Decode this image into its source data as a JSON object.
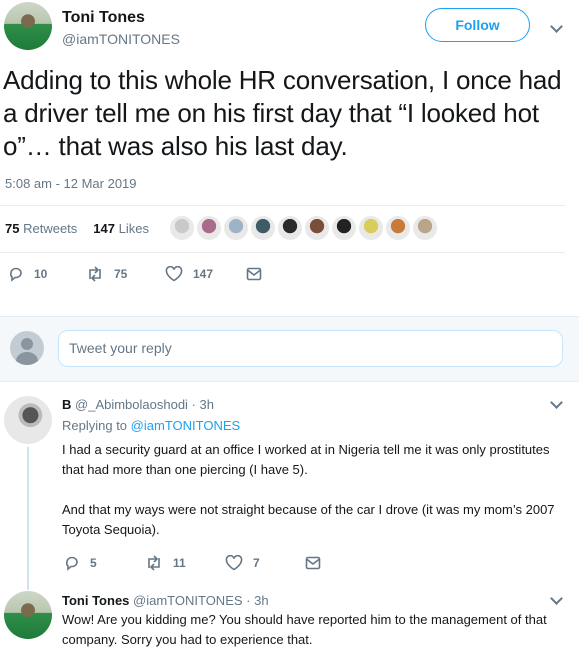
{
  "tweet": {
    "author_name": "Toni Tones",
    "author_handle": "@iamTONITONES",
    "follow_label": "Follow",
    "text": "Adding to this whole HR conversation, I once had a driver tell me on his first day that “I looked hot o”… that was also his last day.",
    "timestamp": "5:08 am - 12 Mar 2019",
    "retweets_count": "75",
    "retweets_label": "Retweets",
    "likes_count": "147",
    "likes_label": "Likes",
    "actions": {
      "reply_count": "10",
      "retweet_count": "75",
      "like_count": "147"
    },
    "liker_colors": [
      "#c9c9c9",
      "#a86b8a",
      "#9fb3c8",
      "#3f5c66",
      "#2a2a2a",
      "#7a4e3a",
      "#222222",
      "#d9cc5a",
      "#c77a3a",
      "#b9a58a"
    ]
  },
  "reply_box": {
    "placeholder": "Tweet your reply"
  },
  "replies": [
    {
      "name": "B",
      "handle": "@_Abimbolaoshodi",
      "time": "· 3h",
      "replying_prefix": "Replying to",
      "replying_to": "@iamTONITONES",
      "body_1": "I had a security guard at an office I worked at in Nigeria tell me it was only prostitutes that had more than one piercing (I have 5).",
      "body_2": "And that my ways were not straight because of the car I drove (it was my mom’s 2007 Toyota Sequoia).",
      "reply_count": "5",
      "retweet_count": "11",
      "like_count": "7"
    },
    {
      "name": "Toni Tones",
      "handle": "@iamTONITONES",
      "time": "· 3h",
      "body_1": "Wow! Are you kidding me? You should have reported him to the management of that company. Sorry you had to experience that."
    }
  ]
}
